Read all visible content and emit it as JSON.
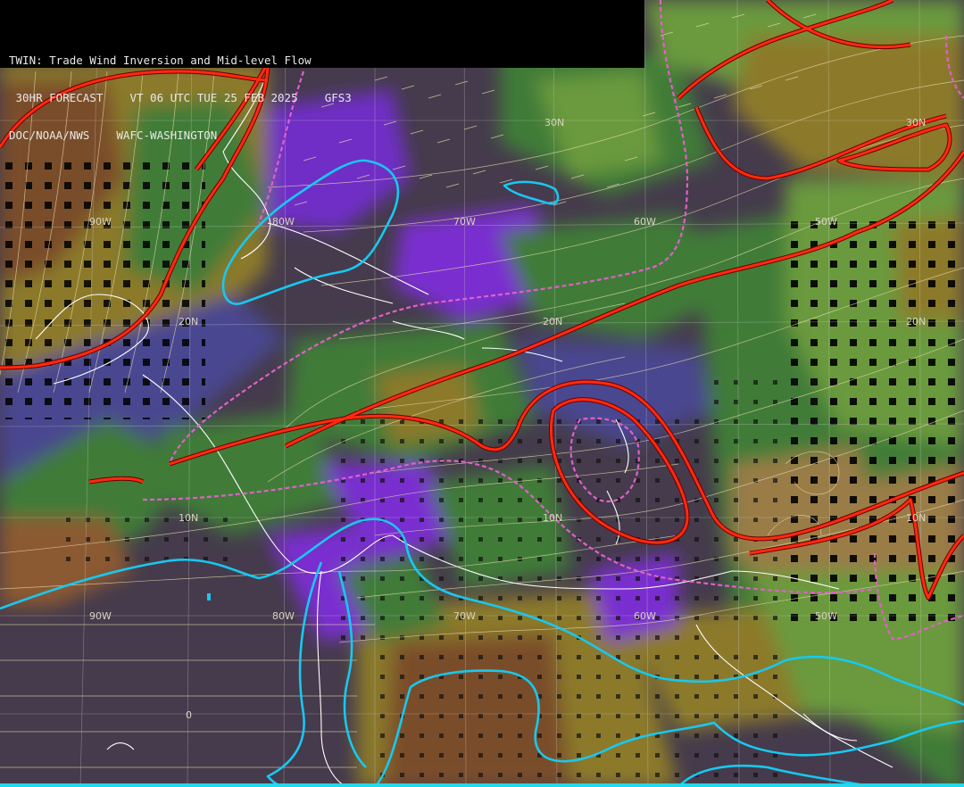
{
  "header": {
    "title": "TWIN: Trade Wind Inversion and Mid-level Flow",
    "forecast": " 30HR FORECAST    VT 06 UTC TUE 25 FEB 2025    GFS3",
    "agency": "DOC/NOAA/NWS    WAFC-WASHINGTON"
  },
  "grid_labels": {
    "lat_30n_a": "30N",
    "lat_30n_b": "30N",
    "lat_20n_a": "20N",
    "lat_20n_b": "20N",
    "lat_20n_c": "20N",
    "lat_10n_a": "10N",
    "lat_10n_b": "10N",
    "lat_10n_c": "10N",
    "lon_90w_a": "90W",
    "lon_80w_a": "80W",
    "lon_70w_a": "70W",
    "lon_60w_a": "60W",
    "lon_50w_a": "50W",
    "lon_90w_b": "90W",
    "lon_80w_b": "80W",
    "lon_70w_b": "70W",
    "lon_60w_b": "60W",
    "lon_50w_b": "50W",
    "lat_0": "0"
  },
  "colors": {
    "background_dark": "#453b4c",
    "purple": "#7a2ed0",
    "indigo": "#4a4690",
    "green_dark": "#3f7c38",
    "green_light": "#6a9a3c",
    "olive": "#8c7a2c",
    "tan": "#9a7c46",
    "brown": "#7a4e2c",
    "red_contour": "#ff2a10",
    "pink_dashed": "#e060c8",
    "cyan_contour": "#18c8f0",
    "coast": "#ffffff",
    "streamline": "#e9dcae"
  }
}
